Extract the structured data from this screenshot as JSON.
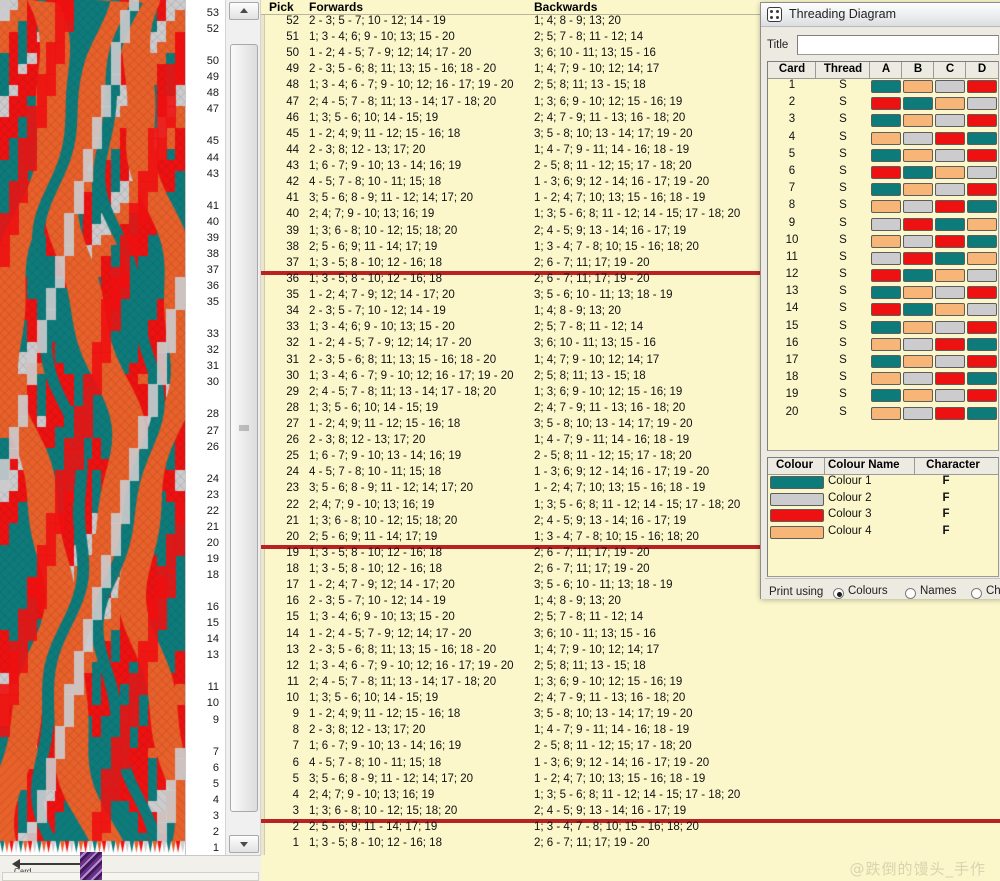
{
  "window": {
    "title": "Threading Diagram",
    "icon": "card-dots-icon"
  },
  "title_field": {
    "label": "Title",
    "value": "",
    "placeholder": ""
  },
  "threading": {
    "headers": [
      "Card",
      "Thread",
      "A",
      "B",
      "C",
      "D"
    ],
    "palette": {
      "teal": "#0e7b7b",
      "gray": "#ccccce",
      "red": "#ee1111",
      "orange": "#f7b578"
    },
    "rows": [
      {
        "card": "1",
        "thread": "S",
        "cells": [
          "teal",
          "orange",
          "gray",
          "red"
        ]
      },
      {
        "card": "2",
        "thread": "S",
        "cells": [
          "red",
          "teal",
          "orange",
          "gray"
        ]
      },
      {
        "card": "3",
        "thread": "S",
        "cells": [
          "teal",
          "orange",
          "gray",
          "red"
        ]
      },
      {
        "card": "4",
        "thread": "S",
        "cells": [
          "orange",
          "gray",
          "red",
          "teal"
        ]
      },
      {
        "card": "5",
        "thread": "S",
        "cells": [
          "teal",
          "orange",
          "gray",
          "red"
        ]
      },
      {
        "card": "6",
        "thread": "S",
        "cells": [
          "red",
          "teal",
          "orange",
          "gray"
        ]
      },
      {
        "card": "7",
        "thread": "S",
        "cells": [
          "teal",
          "orange",
          "gray",
          "red"
        ]
      },
      {
        "card": "8",
        "thread": "S",
        "cells": [
          "orange",
          "gray",
          "red",
          "teal"
        ]
      },
      {
        "card": "9",
        "thread": "S",
        "cells": [
          "gray",
          "red",
          "teal",
          "orange"
        ]
      },
      {
        "card": "10",
        "thread": "S",
        "cells": [
          "orange",
          "gray",
          "red",
          "teal"
        ]
      },
      {
        "card": "11",
        "thread": "S",
        "cells": [
          "gray",
          "red",
          "teal",
          "orange"
        ]
      },
      {
        "card": "12",
        "thread": "S",
        "cells": [
          "red",
          "teal",
          "orange",
          "gray"
        ]
      },
      {
        "card": "13",
        "thread": "S",
        "cells": [
          "teal",
          "orange",
          "gray",
          "red"
        ]
      },
      {
        "card": "14",
        "thread": "S",
        "cells": [
          "red",
          "teal",
          "orange",
          "gray"
        ]
      },
      {
        "card": "15",
        "thread": "S",
        "cells": [
          "teal",
          "orange",
          "gray",
          "red"
        ]
      },
      {
        "card": "16",
        "thread": "S",
        "cells": [
          "orange",
          "gray",
          "red",
          "teal"
        ]
      },
      {
        "card": "17",
        "thread": "S",
        "cells": [
          "teal",
          "orange",
          "gray",
          "red"
        ]
      },
      {
        "card": "18",
        "thread": "S",
        "cells": [
          "orange",
          "gray",
          "red",
          "teal"
        ]
      },
      {
        "card": "19",
        "thread": "S",
        "cells": [
          "teal",
          "orange",
          "gray",
          "red"
        ]
      },
      {
        "card": "20",
        "thread": "S",
        "cells": [
          "orange",
          "gray",
          "red",
          "teal"
        ]
      }
    ]
  },
  "colour_legend": {
    "headers": [
      "Colour",
      "Colour Name",
      "Character"
    ],
    "rows": [
      {
        "swatch": "#0e7b7b",
        "name": "Colour 1",
        "character": "F"
      },
      {
        "swatch": "#ccccce",
        "name": "Colour 2",
        "character": "F"
      },
      {
        "swatch": "#ee1111",
        "name": "Colour 3",
        "character": "F"
      },
      {
        "swatch": "#f7b578",
        "name": "Colour 4",
        "character": "F"
      }
    ]
  },
  "print_using": {
    "label": "Print using",
    "options": [
      {
        "text": "Colours",
        "selected": true
      },
      {
        "text": "Names",
        "selected": false
      },
      {
        "text": "Ch",
        "selected": false
      }
    ]
  },
  "pick_list": {
    "headers": {
      "pick": "Pick",
      "forwards": "Forwards",
      "backwards": "Backwards"
    },
    "separator_after_picks": [
      37,
      20,
      3
    ],
    "cycle_length": 18,
    "cycle": [
      {
        "forwards": "1; 3 - 5; 8 - 10; 12 - 16; 18",
        "backwards": "2; 6 - 7; 11; 17; 19 - 20"
      },
      {
        "forwards": "2; 5 - 6; 9; 11 - 14; 17; 19",
        "backwards": "1; 3 - 4; 7 - 8; 10; 15 - 16; 18; 20"
      },
      {
        "forwards": "1; 3; 6 - 8; 10 - 12; 15; 18; 20",
        "backwards": "2; 4 - 5; 9; 13 - 14; 16 - 17; 19"
      },
      {
        "forwards": "2; 4; 7; 9 - 10; 13; 16; 19",
        "backwards": "1; 3; 5 - 6; 8; 11 - 12; 14 - 15; 17 - 18; 20"
      },
      {
        "forwards": "3; 5 - 6; 8 - 9; 11 - 12; 14; 17; 20",
        "backwards": "1 - 2; 4; 7; 10; 13; 15 - 16; 18 - 19"
      },
      {
        "forwards": "4 - 5; 7 - 8; 10 - 11; 15; 18",
        "backwards": "1 - 3; 6; 9; 12 - 14; 16 - 17; 19 - 20"
      },
      {
        "forwards": "1; 6 - 7; 9 - 10; 13 - 14; 16; 19",
        "backwards": "2 - 5; 8; 11 - 12; 15; 17 - 18; 20"
      },
      {
        "forwards": "2 - 3; 8; 12 - 13; 17; 20",
        "backwards": "1; 4 - 7; 9 - 11; 14 - 16; 18 - 19"
      },
      {
        "forwards": "1 - 2; 4; 9; 11 - 12; 15 - 16; 18",
        "backwards": "3; 5 - 8; 10; 13 - 14; 17; 19 - 20"
      },
      {
        "forwards": "1; 3; 5 - 6; 10; 14 - 15; 19",
        "backwards": "2; 4; 7 - 9; 11 - 13; 16 - 18; 20"
      },
      {
        "forwards": "2; 4 - 5; 7 - 8; 11; 13 - 14; 17 - 18; 20",
        "backwards": "1; 3; 6; 9 - 10; 12; 15 - 16; 19"
      },
      {
        "forwards": "1; 3 - 4; 6 - 7; 9 - 10; 12; 16 - 17; 19 - 20",
        "backwards": "2; 5; 8; 11; 13 - 15; 18"
      },
      {
        "forwards": "2 - 3; 5 - 6; 8; 11; 13; 15 - 16; 18 - 20",
        "backwards": "1; 4; 7; 9 - 10; 12; 14; 17"
      },
      {
        "forwards": "1 - 2; 4 - 5; 7 - 9; 12; 14; 17 - 20",
        "backwards": "3; 6; 10 - 11; 13; 15 - 16"
      },
      {
        "forwards": "1; 3 - 4; 6; 9 - 10; 13; 15 - 20",
        "backwards": "2; 5; 7 - 8; 11 - 12; 14"
      },
      {
        "forwards": "2 - 3; 5 - 7; 10 - 12; 14 - 19",
        "backwards": "1; 4; 8 - 9; 13; 20"
      },
      {
        "forwards": "1 - 2; 4; 7 - 9; 12; 14 - 17; 20",
        "backwards": "3; 5 - 6; 10 - 11; 13; 18 - 19"
      },
      {
        "forwards": "1; 3 - 5; 8 - 10; 12 - 16; 18",
        "backwards": "2; 6 - 7; 11; 17; 19 - 20"
      }
    ],
    "first_pick": 1,
    "last_pick": 52
  },
  "ruler": {
    "numbers": [
      53,
      52,
      50,
      49,
      48,
      47,
      45,
      44,
      43,
      41,
      40,
      39,
      38,
      37,
      36,
      35,
      33,
      32,
      31,
      30,
      28,
      27,
      26,
      24,
      23,
      22,
      21,
      20,
      19,
      18,
      16,
      15,
      14,
      13,
      11,
      10,
      9,
      7,
      6,
      5,
      4,
      3,
      2,
      1
    ]
  },
  "bottom_bar": {
    "card_label": "Card"
  },
  "watermark": "@跌倒的馒头_手作",
  "weave": {
    "colors": [
      "#0e7b7b",
      "#e8602a",
      "#ee1111",
      "#ccccce"
    ],
    "description": "tablet-woven band simulation"
  }
}
